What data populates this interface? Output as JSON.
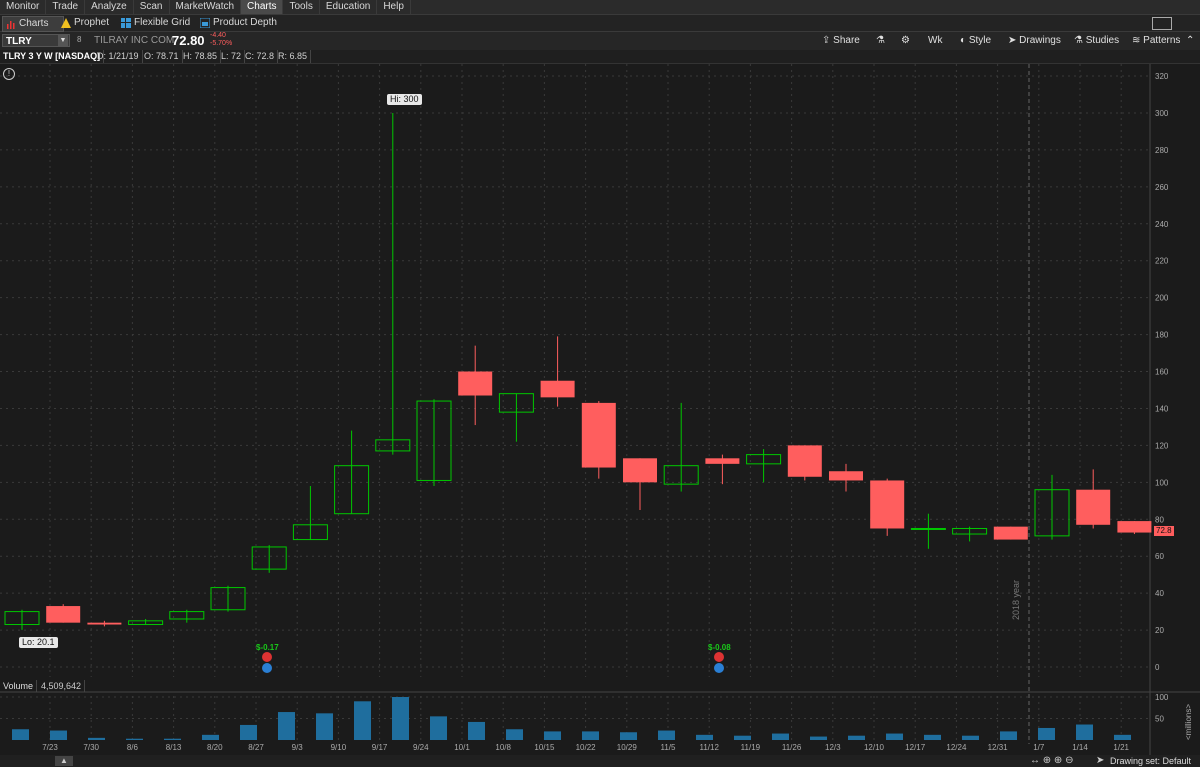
{
  "menu": [
    "Monitor",
    "Trade",
    "Analyze",
    "Scan",
    "MarketWatch",
    "Charts",
    "Tools",
    "Education",
    "Help"
  ],
  "menu_active": "Charts",
  "subtabs": [
    {
      "label": "Charts",
      "icon": "bars-icon"
    },
    {
      "label": "Prophet",
      "icon": "warning-icon"
    },
    {
      "label": "Flexible Grid",
      "icon": "grid-icon"
    },
    {
      "label": "Product Depth",
      "icon": "depth-icon"
    }
  ],
  "symbol": {
    "ticker": "TLRY",
    "company": "TILRAY INC COM",
    "price": "72.80",
    "change": "-4.40",
    "change_pct": "-5.70%"
  },
  "toolbar": {
    "share": "Share",
    "period": "Wk",
    "style": "Style",
    "drawings": "Drawings",
    "studies": "Studies",
    "patterns": "Patterns"
  },
  "info": {
    "title": "TLRY 3 Y W [NASDAQ]",
    "date": "D: 1/21/19",
    "open": "O: 78.71",
    "high": "H: 78.85",
    "low": "L: 72",
    "close": "C: 72.8",
    "range": "R: 6.85"
  },
  "labels": {
    "hi": "Hi: 300",
    "lo": "Lo: 20.1",
    "last": "72.8",
    "year": "2018 year",
    "earn1": "$-0.17",
    "earn2": "$-0.08",
    "volume_label": "Volume",
    "volume_value": "4,509,642",
    "volume_unit": "<millions>",
    "drawing_set": "Drawing set: Default"
  },
  "colors": {
    "up": "#00c800",
    "down": "#ff5e5e",
    "volume": "#1f6e9e",
    "grid": "#3a3a3a",
    "bg": "#1b1b1b"
  },
  "chart_data": {
    "type": "candlestick",
    "price_axis": {
      "min": 0,
      "max": 320,
      "ticks": [
        0,
        20,
        40,
        60,
        80,
        100,
        120,
        140,
        160,
        180,
        200,
        220,
        240,
        260,
        280,
        300,
        320
      ]
    },
    "volume_axis": {
      "min": 0,
      "max": 100,
      "ticks": [
        50,
        100
      ],
      "unit": "<millions>"
    },
    "categories": [
      "7/23",
      "7/30",
      "8/6",
      "8/13",
      "8/20",
      "8/27",
      "9/3",
      "9/10",
      "9/17",
      "9/24",
      "10/1",
      "10/8",
      "10/15",
      "10/22",
      "10/29",
      "11/5",
      "11/12",
      "11/19",
      "11/26",
      "12/3",
      "12/10",
      "12/17",
      "12/24",
      "12/31",
      "1/7",
      "1/14",
      "1/21"
    ],
    "candles": [
      {
        "o": 23,
        "h": 31,
        "l": 20.1,
        "c": 30
      },
      {
        "o": 33,
        "h": 34,
        "l": 24,
        "c": 24
      },
      {
        "o": 24,
        "h": 25,
        "l": 22,
        "c": 23
      },
      {
        "o": 23,
        "h": 26,
        "l": 23,
        "c": 25
      },
      {
        "o": 26,
        "h": 31,
        "l": 24,
        "c": 30
      },
      {
        "o": 31,
        "h": 44,
        "l": 30,
        "c": 43
      },
      {
        "o": 53,
        "h": 66,
        "l": 51,
        "c": 65
      },
      {
        "o": 69,
        "h": 98,
        "l": 69,
        "c": 77
      },
      {
        "o": 83,
        "h": 128,
        "l": 83,
        "c": 109
      },
      {
        "o": 117,
        "h": 300,
        "l": 115,
        "c": 123
      },
      {
        "o": 101,
        "h": 145,
        "l": 98,
        "c": 144
      },
      {
        "o": 160,
        "h": 174,
        "l": 131,
        "c": 147
      },
      {
        "o": 138,
        "h": 148,
        "l": 122,
        "c": 148
      },
      {
        "o": 155,
        "h": 179,
        "l": 141,
        "c": 146
      },
      {
        "o": 143,
        "h": 144,
        "l": 102,
        "c": 108
      },
      {
        "o": 113,
        "h": 113,
        "l": 85,
        "c": 100
      },
      {
        "o": 99,
        "h": 143,
        "l": 95,
        "c": 109
      },
      {
        "o": 113,
        "h": 115,
        "l": 99,
        "c": 110
      },
      {
        "o": 110,
        "h": 118,
        "l": 100,
        "c": 115
      },
      {
        "o": 120,
        "h": 120,
        "l": 101,
        "c": 103
      },
      {
        "o": 106,
        "h": 110,
        "l": 95,
        "c": 101
      },
      {
        "o": 101,
        "h": 102,
        "l": 71,
        "c": 75
      },
      {
        "o": 75,
        "h": 83,
        "l": 64,
        "c": 75
      },
      {
        "o": 72,
        "h": 76,
        "l": 68,
        "c": 75
      },
      {
        "o": 76,
        "h": 76,
        "l": 69,
        "c": 69
      },
      {
        "o": 71,
        "h": 104,
        "l": 69,
        "c": 96
      },
      {
        "o": 96,
        "h": 107,
        "l": 75,
        "c": 77
      },
      {
        "o": 79,
        "h": 79,
        "l": 72,
        "c": 72.8
      }
    ],
    "volume": [
      25,
      22,
      5,
      3,
      3,
      12,
      35,
      65,
      62,
      90,
      100,
      55,
      42,
      25,
      20,
      20,
      18,
      22,
      12,
      10,
      15,
      8,
      10,
      15,
      12,
      10,
      20,
      28,
      36,
      12
    ],
    "earnings": [
      {
        "label": "$-0.17",
        "week": "8/27"
      },
      {
        "label": "$-0.08",
        "week": "11/12"
      }
    ]
  }
}
